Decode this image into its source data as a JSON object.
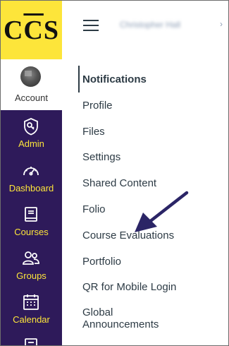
{
  "logo": {
    "pre": "C",
    "mid": "C",
    "post": "S",
    "color": "#fde53a"
  },
  "global_nav": {
    "background": "#2e1a5a",
    "label_color": "#fde53a",
    "account_label": "Account",
    "items": [
      {
        "label": "Admin",
        "icon": "shield-key-icon"
      },
      {
        "label": "Dashboard",
        "icon": "speedometer-icon"
      },
      {
        "label": "Courses",
        "icon": "book-icon"
      },
      {
        "label": "Groups",
        "icon": "people-icon"
      },
      {
        "label": "Calendar",
        "icon": "calendar-icon"
      }
    ]
  },
  "topbar": {
    "breadcrumb_blurred": "Christopher Hall",
    "separator": "›"
  },
  "account_nav": {
    "items": [
      {
        "label": "Notifications",
        "active": true
      },
      {
        "label": "Profile"
      },
      {
        "label": "Files"
      },
      {
        "label": "Settings"
      },
      {
        "label": "Shared Content"
      },
      {
        "label": "Folio"
      },
      {
        "label": "Course Evaluations"
      },
      {
        "label": "Portfolio"
      },
      {
        "label": "QR for Mobile Login"
      },
      {
        "label": "Global"
      }
    ],
    "last_line_2": "Announcements"
  },
  "annotation": {
    "arrow_color": "#2b2566"
  }
}
